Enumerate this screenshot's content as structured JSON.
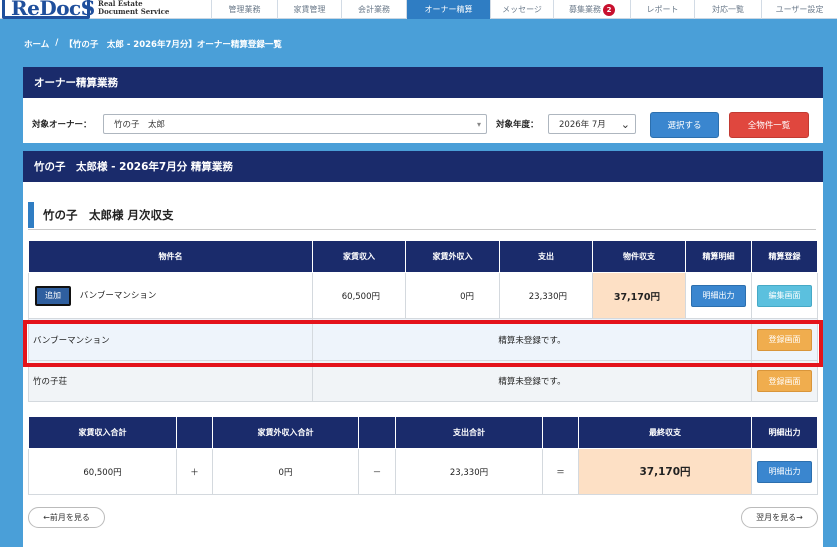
{
  "logo": {
    "main": "ReDocS",
    "sub_line1": "Real Estate",
    "sub_line2": "Document Service"
  },
  "nav": [
    {
      "label": "管理業務",
      "width": 66,
      "active": false,
      "badge": null
    },
    {
      "label": "家賃管理",
      "width": 64,
      "active": false,
      "badge": null
    },
    {
      "label": "会計業務",
      "width": 65,
      "active": false,
      "badge": null
    },
    {
      "label": "オーナー精算",
      "width": 84,
      "active": true,
      "badge": null
    },
    {
      "label": "メッセージ",
      "width": 63,
      "active": false,
      "badge": null
    },
    {
      "label": "募集業務",
      "width": 77,
      "active": false,
      "badge": "2"
    },
    {
      "label": "レポート",
      "width": 64,
      "active": false,
      "badge": null
    },
    {
      "label": "対応一覧",
      "width": 67,
      "active": false,
      "badge": null
    },
    {
      "label": "ユーザー設定",
      "width": 76,
      "active": false,
      "badge": null
    }
  ],
  "breadcrumb": {
    "home": "ホーム",
    "sep": "/",
    "current": "【竹の子　太郎 - 2026年7月分】オーナー精算登録一覧"
  },
  "owner_panel": {
    "title": "オーナー精算業務",
    "owner_label": "対象オーナー：",
    "owner_value": "竹の子　太郎",
    "year_label": "対象年度：",
    "year_value": "2026年 7月",
    "select_button": "選択する",
    "all_props_button": "全物件一覧"
  },
  "monthly_panel": {
    "title": "竹の子　太郎様 - 2026年7月分 精算業務",
    "section_title": "竹の子　太郎様 月次収支"
  },
  "detail_table": {
    "headers": [
      "物件名",
      "家賃収入",
      "家賃外収入",
      "支出",
      "物件収支",
      "精算明細",
      "精算登録"
    ],
    "row1": {
      "add_button": "追加",
      "property": "バンブーマンション",
      "rent_income": "60,500円",
      "other_income": "0円",
      "expense": "23,330円",
      "balance": "37,170円",
      "detail_button": "明細出力",
      "edit_button": "編集画面"
    },
    "row2": {
      "property": "バンブーマンション",
      "status": "精算未登録です。",
      "register_button": "登録画面"
    },
    "row3": {
      "property": "竹の子荘",
      "status": "精算未登録です。",
      "register_button": "登録画面"
    }
  },
  "totals_table": {
    "headers": [
      "家賃収入合計",
      "家賃外収入合計",
      "支出合計",
      "最終収支",
      "明細出力"
    ],
    "rent_total": "60,500円",
    "op_plus": "＋",
    "other_total": "0円",
    "op_minus": "－",
    "expense_total": "23,330円",
    "op_equal": "＝",
    "final_balance": "37,170円",
    "detail_button": "明細出力"
  },
  "pager": {
    "prev": "←前月を見る",
    "next": "翌月を見る→"
  }
}
